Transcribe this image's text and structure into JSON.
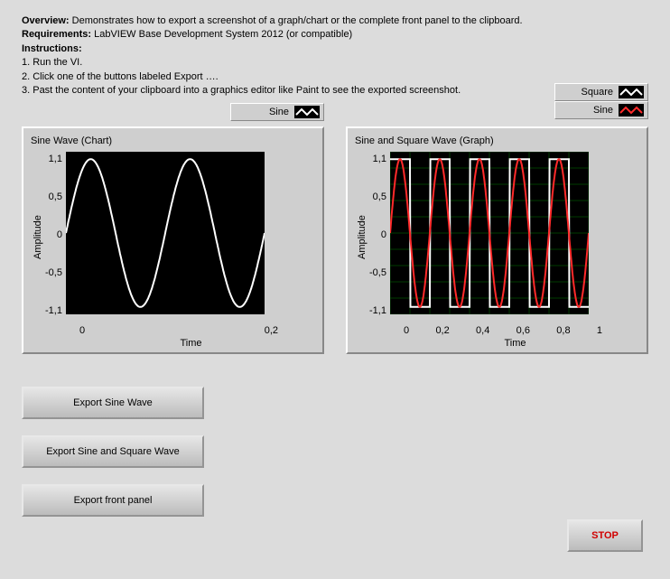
{
  "header": {
    "overview_label": "Overview:",
    "overview_text": " Demonstrates how to export a screenshot of a graph/chart or the complete front panel to the clipboard.",
    "requirements_label": "Requirements:",
    "requirements_text": " LabVIEW Base Development System 2012 (or compatible)",
    "instructions_label": "Instructions:",
    "step1": "1. Run the VI.",
    "step2": "2. Click one of the buttons labeled Export ….",
    "step3": "3. Past the content of your clipboard into a graphics editor like Paint to see the exported screenshot."
  },
  "chart1": {
    "title": "Sine Wave (Chart)",
    "legend": [
      {
        "label": "Sine",
        "color": "#ffffff"
      }
    ],
    "ylabel": "Amplitude",
    "xlabel": "Time",
    "yticks": [
      "1,1",
      "0,5",
      "0",
      "-0,5",
      "-1,1"
    ],
    "xticks": [
      "0",
      "0,2"
    ]
  },
  "chart2": {
    "title": "Sine and Square Wave (Graph)",
    "legend": [
      {
        "label": "Square",
        "color": "#ffffff"
      },
      {
        "label": "Sine",
        "color": "#ff2a2a"
      }
    ],
    "ylabel": "Amplitude",
    "xlabel": "Time",
    "yticks": [
      "1,1",
      "0,5",
      "0",
      "-0,5",
      "-1,1"
    ],
    "xticks": [
      "0",
      "0,2",
      "0,4",
      "0,6",
      "0,8",
      "1"
    ]
  },
  "buttons": {
    "export_sine": "Export Sine Wave",
    "export_both": "Export Sine and Square Wave",
    "export_panel": "Export front panel",
    "stop": "STOP"
  },
  "chart_data": [
    {
      "type": "line",
      "title": "Sine Wave (Chart)",
      "xlabel": "Time",
      "ylabel": "Amplitude",
      "xlim": [
        0,
        0.2
      ],
      "ylim": [
        -1.1,
        1.1
      ],
      "series": [
        {
          "name": "Sine",
          "color": "#ffffff",
          "function": "sin",
          "amplitude": 1.0,
          "frequency_hz": 10,
          "phase": 0
        }
      ]
    },
    {
      "type": "line",
      "title": "Sine and Square Wave (Graph)",
      "xlabel": "Time",
      "ylabel": "Amplitude",
      "xlim": [
        0,
        1
      ],
      "ylim": [
        -1.1,
        1.1
      ],
      "grid": true,
      "series": [
        {
          "name": "Square",
          "color": "#ffffff",
          "function": "square",
          "amplitude": 1.0,
          "frequency_hz": 5,
          "phase": 0
        },
        {
          "name": "Sine",
          "color": "#ff2a2a",
          "function": "sin",
          "amplitude": 1.0,
          "frequency_hz": 5,
          "phase": 0
        }
      ]
    }
  ]
}
